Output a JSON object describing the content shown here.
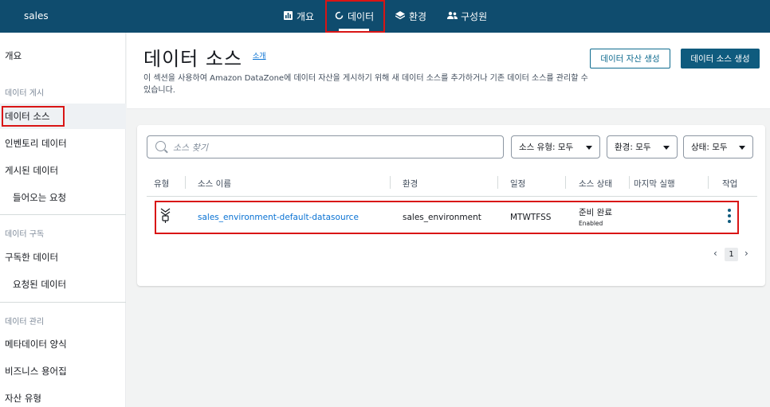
{
  "topbar": {
    "project_name": "sales",
    "tabs": [
      {
        "label": "개요",
        "icon": "chart-icon"
      },
      {
        "label": "데이터",
        "icon": "data-ring-icon"
      },
      {
        "label": "환경",
        "icon": "layers-icon"
      },
      {
        "label": "구성원",
        "icon": "people-icon"
      }
    ],
    "active_tab": "데이터"
  },
  "sidebar": {
    "overview": "개요",
    "section_publish": "데이터 게시",
    "data_sources": "데이터 소스",
    "inventory": "인벤토리 데이터",
    "published": "게시된 데이터",
    "incoming_requests": "들어오는 요청",
    "section_subscribe": "데이터 구독",
    "subscribed": "구독한 데이터",
    "requested": "요청된 데이터",
    "section_manage": "데이터 관리",
    "metadata_forms": "메타데이터 양식",
    "glossaries": "비즈니스 용어집",
    "asset_types": "자산 유형"
  },
  "header": {
    "title": "데이터 소스",
    "info_link": "소개",
    "description": "이 섹션을 사용하여 Amazon DataZone에 데이터 자산을 게시하기 위해 새 데이터 소스를 추가하거나 기존 데이터 소스를 관리할 수 있습니다.",
    "create_asset_button": "데이터 자산 생성",
    "create_source_button": "데이터 소스 생성"
  },
  "filters": {
    "search_placeholder": "소스 찾기",
    "source_type": "소스 유형: 모두",
    "environment": "환경: 모두",
    "status": "상태: 모두"
  },
  "table": {
    "columns": [
      "유형",
      "소스 이름",
      "환경",
      "일정",
      "소스 상태",
      "마지막 실행",
      "작업"
    ],
    "rows": [
      {
        "type_icon": "glue-crawler-icon",
        "name": "sales_environment-default-datasource",
        "environment": "sales_environment",
        "schedule": "MTWTFSS",
        "status": "준비 완료",
        "status_sub": "Enabled",
        "last_run": ""
      }
    ]
  },
  "pagination": {
    "current_page": "1"
  },
  "colors": {
    "topbar_bg": "#0f4c6e",
    "primary_button": "#0f5b7e",
    "link": "#0972d3",
    "highlight_box": "#d91515"
  }
}
